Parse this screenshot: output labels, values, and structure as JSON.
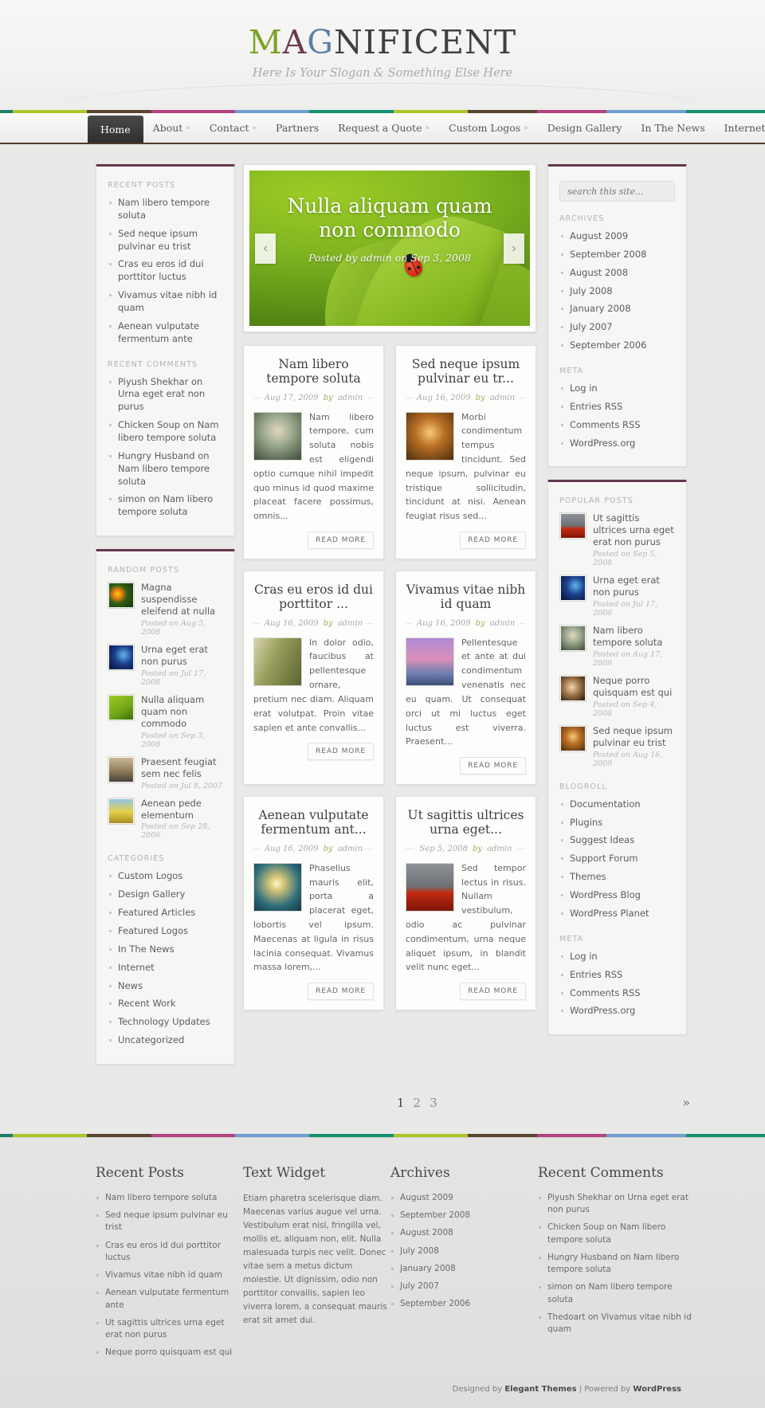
{
  "header": {
    "logo_part1": "MA",
    "logo_m": "M",
    "logo_a": "A",
    "logo_g": "G",
    "logo_rest": "NIFICENT",
    "slogan": "Here Is Your Slogan & Something Else Here"
  },
  "nav": {
    "items": [
      {
        "label": "Home",
        "caret": "",
        "current": true
      },
      {
        "label": "About",
        "caret": "»",
        "current": false
      },
      {
        "label": "Contact",
        "caret": "»",
        "current": false
      },
      {
        "label": "Partners",
        "caret": "",
        "current": false
      },
      {
        "label": "Request a Quote",
        "caret": "»",
        "current": false
      },
      {
        "label": "Custom Logos",
        "caret": "»",
        "current": false
      },
      {
        "label": "Design Gallery",
        "caret": "",
        "current": false
      },
      {
        "label": "In The News",
        "caret": "",
        "current": false
      },
      {
        "label": "Internet",
        "caret": "»",
        "current": false
      }
    ]
  },
  "stripe_colors": [
    "#1f7f6b",
    "#a9c62c",
    "#5a4632",
    "#b4437f",
    "#6f9fd0",
    "#169170",
    "#a9c62c",
    "#5a4632",
    "#b4437f",
    "#6f9fd0",
    "#169170"
  ],
  "slider": {
    "title": "Nulla aliquam quam non commodo",
    "meta": "Posted by admin on Sep 3, 2008",
    "prev": "‹",
    "next": "›"
  },
  "left_sidebar": {
    "recent_posts_title": "RECENT POSTS",
    "recent_posts": [
      "Nam libero tempore soluta",
      "Sed neque ipsum pulvinar eu trist",
      "Cras eu eros id dui porttitor luctus",
      "Vivamus vitae nibh id quam",
      "Aenean vulputate fermentum ante"
    ],
    "recent_comments_title": "RECENT COMMENTS",
    "recent_comments": [
      "Piyush Shekhar on Urna eget erat non purus",
      "Chicken Soup on Nam libero tempore soluta",
      "Hungry Husband on Nam libero tempore soluta",
      "simon on Nam libero tempore soluta"
    ],
    "random_posts_title": "RANDOM POSTS",
    "random_posts": [
      {
        "title": "Magna suspendisse eleifend at nulla",
        "date": "Posted on Aug 5, 2008"
      },
      {
        "title": "Urna eget erat non purus",
        "date": "Posted on Jul 17, 2008"
      },
      {
        "title": "Nulla aliquam quam non commodo",
        "date": "Posted on Sep 3, 2008"
      },
      {
        "title": "Praesent feugiat sem nec felis",
        "date": "Posted on Jul 8, 2007"
      },
      {
        "title": "Aenean pede elementum",
        "date": "Posted on Sep 28, 2006"
      }
    ],
    "categories_title": "CATEGORIES",
    "categories": [
      "Custom Logos",
      "Design Gallery",
      "Featured Articles",
      "Featured Logos",
      "In The News",
      "Internet",
      "News",
      "Recent Work",
      "Technology Updates",
      "Uncategorized"
    ]
  },
  "right_sidebar": {
    "search_placeholder": "search this site...",
    "archives_title": "ARCHIVES",
    "archives": [
      "August 2009",
      "September 2008",
      "August 2008",
      "July 2008",
      "January 2008",
      "July 2007",
      "September 2006"
    ],
    "meta_title": "META",
    "meta": [
      "Log in",
      "Entries RSS",
      "Comments RSS",
      "WordPress.org"
    ],
    "popular_posts_title": "POPULAR POSTS",
    "popular_posts": [
      {
        "title": "Ut sagittis ultrices urna eget erat non purus",
        "date": "Posted on Sep 5, 2008"
      },
      {
        "title": "Urna eget erat non purus",
        "date": "Posted on Jul 17, 2008"
      },
      {
        "title": "Nam libero tempore soluta",
        "date": "Posted on Aug 17, 2009"
      },
      {
        "title": "Neque porro quisquam est qui",
        "date": "Posted on Sep 4, 2008"
      },
      {
        "title": "Sed neque ipsum pulvinar eu trist",
        "date": "Posted on Aug 16, 2009"
      }
    ],
    "blogroll_title": "BLOGROLL",
    "blogroll": [
      "Documentation",
      "Plugins",
      "Suggest Ideas",
      "Support Forum",
      "Themes",
      "WordPress Blog",
      "WordPress Planet"
    ],
    "meta2_title": "META",
    "meta2": [
      "Log in",
      "Entries RSS",
      "Comments RSS",
      "WordPress.org"
    ]
  },
  "posts": [
    {
      "title": "Nam libero tempore soluta",
      "date": "Aug 17, 2009",
      "by": "by",
      "author": "admin",
      "excerpt": "Nam libero tempore, cum soluta nobis est eligendi optio cumque nihil impedit quo minus id quod maxime placeat facere possimus, omnis...",
      "readmore": "READ MORE"
    },
    {
      "title": "Sed neque ipsum pulvinar eu tr...",
      "date": "Aug 16, 2009",
      "by": "by",
      "author": "admin",
      "excerpt": "Morbi condimentum tempus tincidunt. Sed neque ipsum, pulvinar eu tristique sollicitudin, tincidunt at nisi. Aenean feugiat risus sed...",
      "readmore": "READ MORE"
    },
    {
      "title": "Cras eu eros id dui porttitor ...",
      "date": "Aug 16, 2009",
      "by": "by",
      "author": "admin",
      "excerpt": "In dolor odio, faucibus at pellentesque ornare, pretium nec diam. Aliquam erat volutpat. Proin vitae sapien et ante convallis...",
      "readmore": "READ MORE"
    },
    {
      "title": "Vivamus vitae nibh id quam",
      "date": "Aug 16, 2009",
      "by": "by",
      "author": "admin",
      "excerpt": "Pellentesque et ante at dui condimentum venenatis nec eu quam. Ut consequat orci ut mi luctus eget luctus est viverra. Praesent...",
      "readmore": "READ MORE"
    },
    {
      "title": "Aenean vulputate fermentum ant...",
      "date": "Aug 16, 2009",
      "by": "by",
      "author": "admin",
      "excerpt": "Phasellus mauris elit, porta a placerat eget, lobortis vel ipsum. Maecenas at ligula in risus lacinia consequat. Vivamus massa lorem,...",
      "readmore": "READ MORE"
    },
    {
      "title": "Ut sagittis ultrices urna eget...",
      "date": "Sep 5, 2008",
      "by": "by",
      "author": "admin",
      "excerpt": "Sed tempor lectus in risus. Nullam vestibulum, odio ac pulvinar condimentum, urna neque aliquet ipsum, in blandit velit nunc eget...",
      "readmore": "READ MORE"
    }
  ],
  "pagination": {
    "pages": [
      "1",
      "2",
      "3"
    ],
    "current": "1",
    "next": "»"
  },
  "footer": {
    "col1_title": "Recent Posts",
    "col1_items": [
      "Nam libero tempore soluta",
      "Sed neque ipsum pulvinar eu trist",
      "Cras eu eros id dui porttitor luctus",
      "Vivamus vitae nibh id quam",
      "Aenean vulputate fermentum ante",
      "Ut sagittis ultrices urna eget erat non purus",
      "Neque porro quisquam est qui"
    ],
    "col2_title": "Text Widget",
    "col2_text": "Etiam pharetra scelerisque diam. Maecenas varius augue vel urna. Vestibulum erat nisl, fringilla vel, mollis et, aliquam non, elit. Nulla malesuada turpis nec velit. Donec vitae sem a metus dictum molestie. Ut dignissim, odio non porttitor convallis, sapien leo viverra lorem, a consequat mauris erat sit amet dui.",
    "col3_title": "Archives",
    "col3_items": [
      "August 2009",
      "September 2008",
      "August 2008",
      "July 2008",
      "January 2008",
      "July 2007",
      "September 2006"
    ],
    "col4_title": "Recent Comments",
    "col4_items": [
      "Piyush Shekhar on Urna eget erat non purus",
      "Chicken Soup on Nam libero tempore soluta",
      "Hungry Husband on Nam libero tempore soluta",
      "simon on Nam libero tempore soluta",
      "Thedoart on Vivamus vitae nibh id quam"
    ],
    "credit_pre": "Designed by ",
    "credit_brand1": "Elegant Themes",
    "credit_mid": " | Powered by ",
    "credit_brand2": "WordPress"
  }
}
